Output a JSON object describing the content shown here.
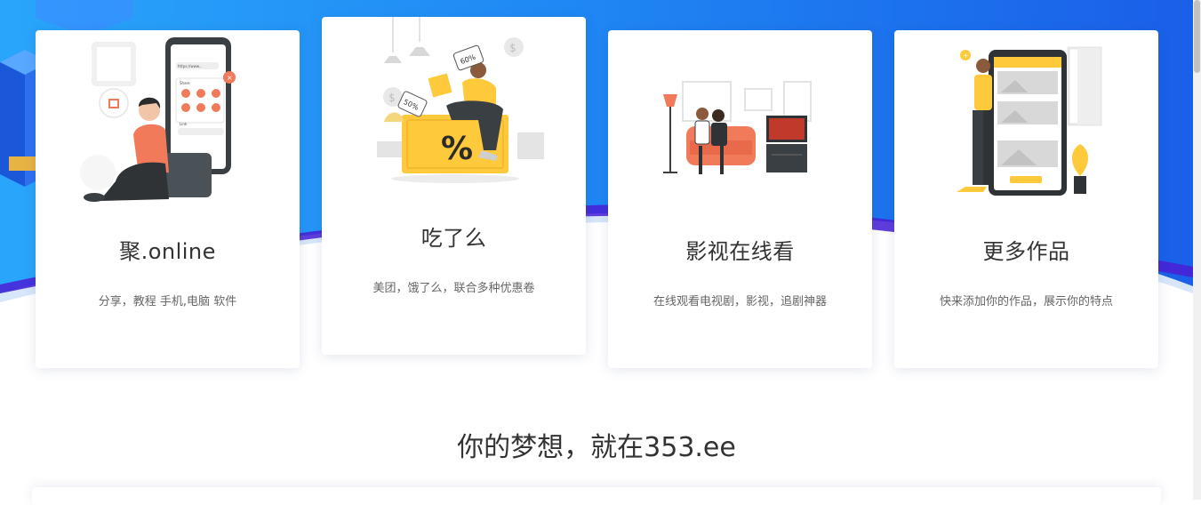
{
  "cards": [
    {
      "title": "聚.online",
      "desc": "分享，教程 手机,电脑 软件",
      "illustration_icon": "share-phone-illustration-icon"
    },
    {
      "title": "吃了么",
      "desc": "美团，饿了么，联合多种优惠卷",
      "illustration_icon": "discount-shopping-illustration-icon"
    },
    {
      "title": "影视在线看",
      "desc": "在线观看电视剧，影视，追剧神器",
      "illustration_icon": "couple-watching-tv-illustration-icon"
    },
    {
      "title": "更多作品",
      "desc": "快来添加你的作品，展示你的特点",
      "illustration_icon": "phone-gallery-illustration-icon"
    }
  ],
  "headline": "你的梦想，就在353.ee",
  "illustration_text": {
    "tag_60": "60%",
    "tag_50": "50%",
    "percent": "%",
    "url": "https://www...",
    "share": "Share",
    "link": "Link"
  },
  "colors": {
    "hero_blue": "#1f78f0",
    "hero_light": "#2aa0f8",
    "accent_purple": "#4a1fd6",
    "accent_orange": "#f07a5a",
    "accent_yellow": "#ffc93c",
    "card_bg": "#ffffff"
  }
}
